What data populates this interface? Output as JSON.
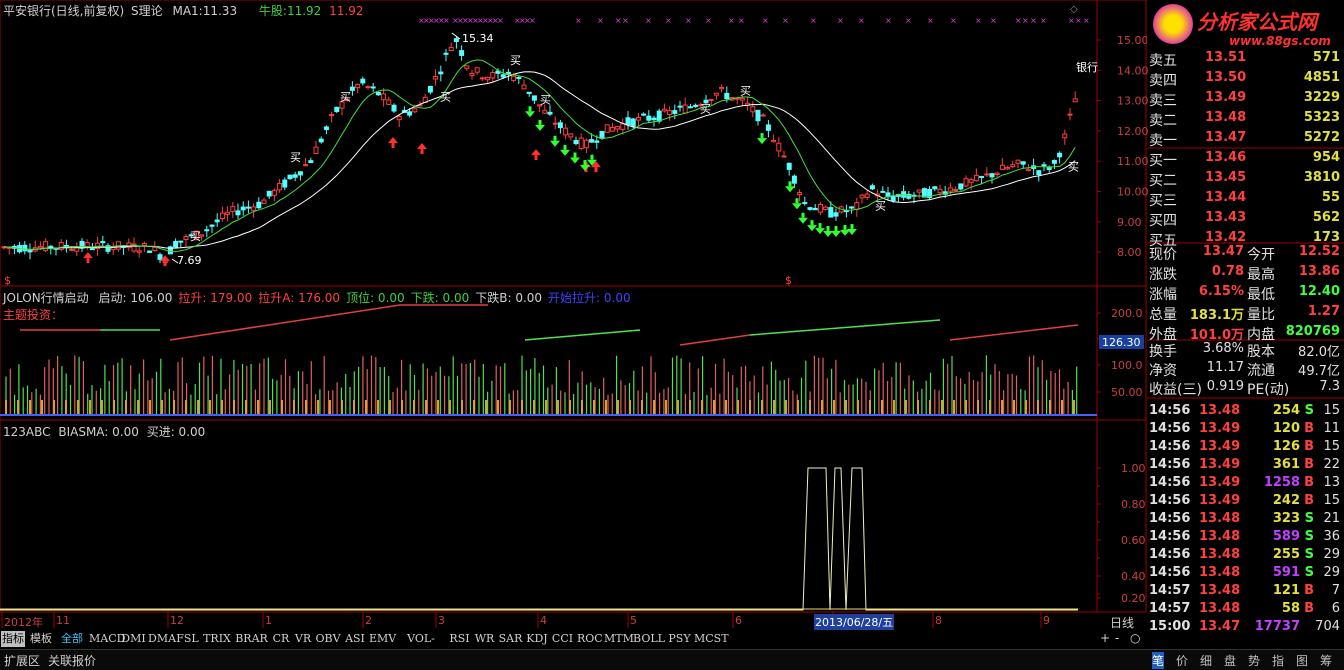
{
  "header": {
    "title": "平安银行(日线,前复权)",
    "indicator": "S理论",
    "ma_label": "MA1:",
    "ma_value": "11.33",
    "bull_label": "牛股:",
    "bull_v1": "11.92",
    "bull_v2": "11.92"
  },
  "main_chart": {
    "high_label": "15.34",
    "low_label": "7.69",
    "y_ticks": [
      "15.00",
      "14.00",
      "13.00",
      "12.00",
      "11.00",
      "10.00",
      "9.00",
      "8.00"
    ],
    "buy_label": "买",
    "end_label": "银行",
    "marker": "$"
  },
  "panel2": {
    "name": "JOLON行情启动",
    "items": [
      {
        "label": "启动: 106.00",
        "color": "#d0d0d0"
      },
      {
        "label": "拉升: 179.00",
        "color": "#ff4040"
      },
      {
        "label": "拉升A: 176.00",
        "color": "#ff4040"
      },
      {
        "label": "顶位: 0.00",
        "color": "#40d040"
      },
      {
        "label": "下跌: 0.00",
        "color": "#40d040"
      },
      {
        "label": "下跌B: 0.00",
        "color": "#d0d0d0"
      },
      {
        "label": "开始拉升: 0.00",
        "color": "#4040ff"
      }
    ],
    "theme": "主题投资：",
    "y_ticks": [
      "200.0",
      "150.0",
      "100.0",
      "50.00"
    ],
    "current": "126.30"
  },
  "panel3": {
    "name": "123ABC",
    "items": [
      "BIASMA: 0.00",
      "买进: 0.00"
    ],
    "y_ticks": [
      "1.00",
      "0.80",
      "0.60",
      "0.40",
      "0.20"
    ]
  },
  "chart_data": {
    "type": "candlestick",
    "x_labels": [
      "2012年",
      "11",
      "12",
      "1",
      "2",
      "3",
      "4",
      "5",
      "6",
      "7",
      "8",
      "9"
    ],
    "cursor_date": "2013/06/28/五",
    "period": "日线",
    "series": [
      {
        "name": "MA1",
        "last": 11.33
      }
    ],
    "ylim": [
      7.5,
      15.5
    ]
  },
  "quote": {
    "logo": "分析家公式网",
    "url": "www.88gs.com",
    "sells": [
      {
        "label": "卖五",
        "price": "13.51",
        "vol": "571"
      },
      {
        "label": "卖四",
        "price": "13.50",
        "vol": "4851"
      },
      {
        "label": "卖三",
        "price": "13.49",
        "vol": "3229"
      },
      {
        "label": "卖二",
        "price": "13.48",
        "vol": "5323"
      },
      {
        "label": "卖一",
        "price": "13.47",
        "vol": "5272"
      }
    ],
    "buys": [
      {
        "label": "买一",
        "price": "13.46",
        "vol": "954"
      },
      {
        "label": "买二",
        "price": "13.45",
        "vol": "3810"
      },
      {
        "label": "买三",
        "price": "13.44",
        "vol": "55"
      },
      {
        "label": "买四",
        "price": "13.43",
        "vol": "562"
      },
      {
        "label": "买五",
        "price": "13.42",
        "vol": "173"
      }
    ],
    "stats": [
      {
        "l1": "现价",
        "v1": "13.47",
        "c1": "#ff4040",
        "l2": "今开",
        "v2": "12.52",
        "c2": "#ff4040"
      },
      {
        "l1": "涨跌",
        "v1": "0.78",
        "c1": "#ff4040",
        "l2": "最高",
        "v2": "13.86",
        "c2": "#ff4040"
      },
      {
        "l1": "涨幅",
        "v1": "6.15%",
        "c1": "#ff4040",
        "l2": "最低",
        "v2": "12.40",
        "c2": "#40ff40"
      },
      {
        "l1": "总量",
        "v1": "183.1万",
        "c1": "#e0e040",
        "l2": "量比",
        "v2": "1.27",
        "c2": "#ff4040"
      },
      {
        "l1": "外盘",
        "v1": "101.0万",
        "c1": "#ff4040",
        "l2": "内盘",
        "v2": "820769",
        "c2": "#40ff40"
      }
    ],
    "fin": [
      {
        "l1": "换手",
        "v1": "3.68%",
        "l2": "股本",
        "v2": "82.0亿"
      },
      {
        "l1": "净资",
        "v1": "11.17",
        "l2": "流通",
        "v2": "49.7亿"
      },
      {
        "l1": "收益(三)",
        "v1": "0.919",
        "l2": "PE(动)",
        "v2": "7.3"
      }
    ],
    "ticks": [
      {
        "t": "14:56",
        "p": "13.48",
        "v": "254",
        "s": "S",
        "n": "15"
      },
      {
        "t": "14:56",
        "p": "13.49",
        "v": "120",
        "s": "B",
        "n": "11"
      },
      {
        "t": "14:56",
        "p": "13.49",
        "v": "126",
        "s": "B",
        "n": "15"
      },
      {
        "t": "14:56",
        "p": "13.49",
        "v": "361",
        "s": "B",
        "n": "22"
      },
      {
        "t": "14:56",
        "p": "13.49",
        "v": "1258",
        "s": "B",
        "n": "13"
      },
      {
        "t": "14:56",
        "p": "13.49",
        "v": "242",
        "s": "B",
        "n": "15"
      },
      {
        "t": "14:56",
        "p": "13.48",
        "v": "323",
        "s": "S",
        "n": "21"
      },
      {
        "t": "14:56",
        "p": "13.48",
        "v": "589",
        "s": "S",
        "n": "36"
      },
      {
        "t": "14:56",
        "p": "13.48",
        "v": "255",
        "s": "S",
        "n": "29"
      },
      {
        "t": "14:56",
        "p": "13.48",
        "v": "591",
        "s": "S",
        "n": "29"
      },
      {
        "t": "14:57",
        "p": "13.48",
        "v": "121",
        "s": "B",
        "n": "7"
      },
      {
        "t": "14:57",
        "p": "13.48",
        "v": "58",
        "s": "B",
        "n": "6"
      },
      {
        "t": "15:00",
        "p": "13.47",
        "v": "17737",
        "s": "",
        "n": "704"
      }
    ]
  },
  "tabs": [
    "指标",
    "模板",
    "全部",
    "MACD",
    "DMI",
    "DMA",
    "FSL",
    "TRIX",
    "BRAR",
    "CR",
    "VR",
    "OBV",
    "ASI",
    "EMV",
    "VOL-TDX",
    "RSI",
    "WR",
    "SAR",
    "KDJ",
    "CCI",
    "ROC",
    "MTM",
    "BOLL",
    "PSY",
    "MCST"
  ],
  "bottom_tabs": [
    "扩展区",
    "关联报价"
  ],
  "bottom_nav": [
    "笔",
    "价",
    "细",
    "盘",
    "势",
    "指",
    "图",
    "筹"
  ],
  "zoom_controls": [
    "+",
    "-",
    "○"
  ]
}
